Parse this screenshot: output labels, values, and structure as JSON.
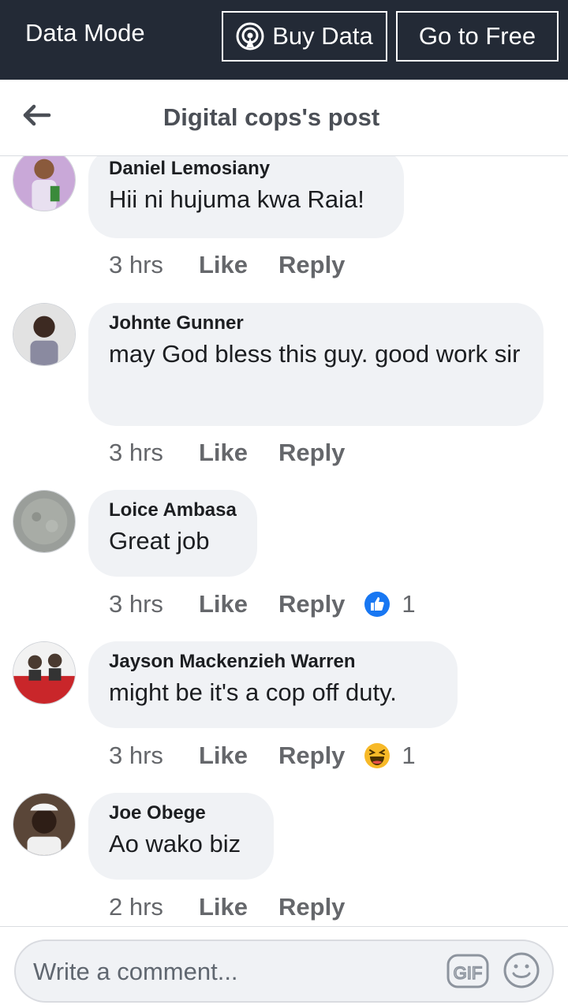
{
  "topbar": {
    "data_mode": "Data Mode",
    "buy_data": "Buy Data",
    "go_to_free": "Go to Free"
  },
  "header": {
    "title": "Digital cops's post"
  },
  "comments": [
    {
      "author": "Daniel Lemosiany",
      "text": "Hii ni hujuma kwa Raia!",
      "time": "3 hrs",
      "like": "Like",
      "reply": "Reply"
    },
    {
      "author": "Johnte Gunner",
      "text": "may God bless this guy. good work sir",
      "time": "3 hrs",
      "like": "Like",
      "reply": "Reply"
    },
    {
      "author": "Loice Ambasa",
      "text": "Great job",
      "time": "3 hrs",
      "like": "Like",
      "reply": "Reply",
      "reaction": {
        "icon": "like-reaction-icon",
        "count": "1"
      }
    },
    {
      "author": "Jayson Mackenzieh Warren",
      "text": "might be it's a cop off duty.",
      "time": "3 hrs",
      "like": "Like",
      "reply": "Reply",
      "reaction": {
        "icon": "haha-reaction-icon",
        "count": "1"
      }
    },
    {
      "author": "Joe Obege",
      "text": "Ao wako biz",
      "time": "2 hrs",
      "like": "Like",
      "reply": "Reply"
    }
  ],
  "composer": {
    "placeholder": "Write a comment...",
    "gif_label": "GIF"
  },
  "colors": {
    "topbar_bg": "#232a36",
    "bubble_bg": "#f0f2f5",
    "meta_text": "#65676b",
    "like_blue": "#1877f2",
    "haha_yellow": "#f7b928"
  }
}
